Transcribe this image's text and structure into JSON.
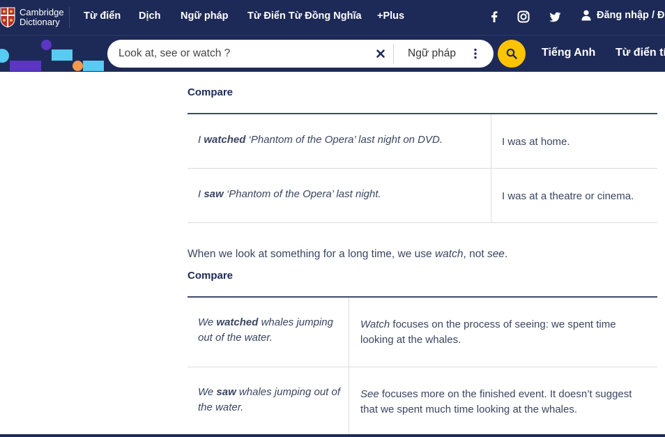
{
  "header": {
    "logo": {
      "line1": "Cambridge",
      "line2": "Dictionary"
    },
    "nav": [
      "Từ điển",
      "Dịch",
      "Ngữ pháp",
      "Từ Điển Từ Đồng Nghĩa",
      "+Plus"
    ],
    "social": [
      "facebook-icon",
      "instagram-icon",
      "twitter-icon"
    ],
    "login_label": "Đăng nhập / Đ"
  },
  "search": {
    "value": "Look at, see or watch ?",
    "scope": "Ngữ pháp",
    "lang_links": [
      "Tiếng Anh",
      "Từ điển tí"
    ]
  },
  "colors": {
    "nav_bg": "#1d2a57",
    "search_button": "#fec400",
    "deco_purple": "#5b36c4",
    "deco_cyan": "#56ccf2",
    "deco_orange": "#f2994a"
  },
  "content": {
    "compare1": {
      "heading": "Compare",
      "rows": [
        {
          "ex_pre": "I ",
          "ex_bold": "watched",
          "ex_post": " ‘Phantom of the Opera’ last night on DVD.",
          "note": "I was at home."
        },
        {
          "ex_pre": "I ",
          "ex_bold": "saw",
          "ex_post": " ‘Phantom of the Opera’ last night.",
          "note": "I was at a theatre or cinema."
        }
      ]
    },
    "paragraph": {
      "t1": "When we look at something for a long time, we use ",
      "i1": "watch",
      "t2": ", not ",
      "i2": "see",
      "t3": "."
    },
    "compare2": {
      "heading": "Compare",
      "rows": [
        {
          "ex_pre": "We ",
          "ex_bold": "watched",
          "ex_post": " whales jumping out of the water.",
          "note_italic": "Watch",
          "note_rest": " focuses on the process of seeing: we spent time looking at the whales."
        },
        {
          "ex_pre": "We ",
          "ex_bold": "saw",
          "ex_post": " whales jumping out of the water.",
          "note_italic": "See",
          "note_rest": " focuses more on the finished event. It doesn’t suggest that we spent much time looking at the whales."
        }
      ]
    }
  }
}
